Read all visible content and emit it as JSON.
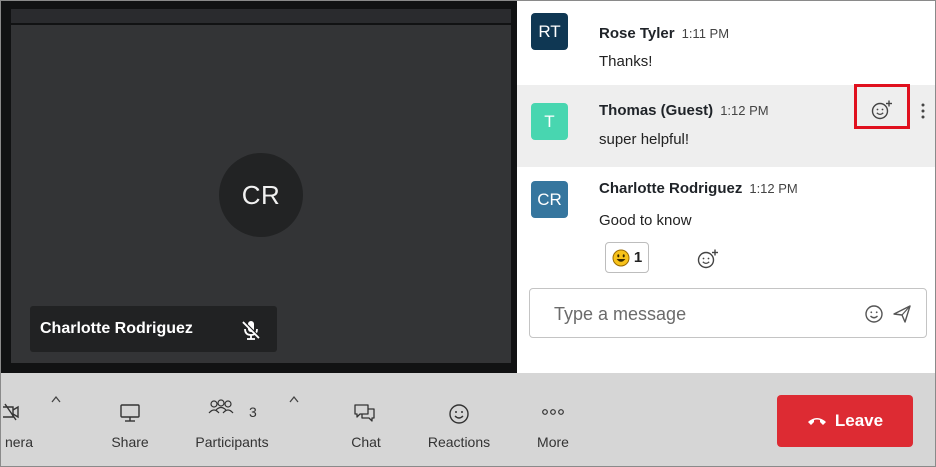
{
  "video": {
    "avatar_initials": "CR",
    "participant_name": "Charlotte Rodriguez",
    "mic_state": "muted"
  },
  "chat": {
    "messages": [
      {
        "initials": "RT",
        "sender": "Rose Tyler",
        "time": "1:11 PM",
        "text": "Thanks!",
        "avatar_color": "#0f3753"
      },
      {
        "initials": "T",
        "sender": "Thomas (Guest)",
        "time": "1:12 PM",
        "text": "super helpful!",
        "avatar_color": "#48d6b0"
      },
      {
        "initials": "CR",
        "sender": "Charlotte Rodriguez",
        "time": "1:12 PM",
        "text": "Good to know",
        "avatar_color": "#36769e"
      }
    ],
    "reaction": {
      "emoji": "grinning-face",
      "count": "1"
    },
    "input_placeholder": "Type a message"
  },
  "toolbar": {
    "camera_label": "nera",
    "share_label": "Share",
    "participants_label": "Participants",
    "participants_count": "3",
    "chat_label": "Chat",
    "reactions_label": "Reactions",
    "more_label": "More",
    "leave_label": "Leave"
  },
  "colors": {
    "leave": "#dd2b33",
    "highlight_box": "#e0101e",
    "toolbar_bg": "#d6d6d6"
  }
}
